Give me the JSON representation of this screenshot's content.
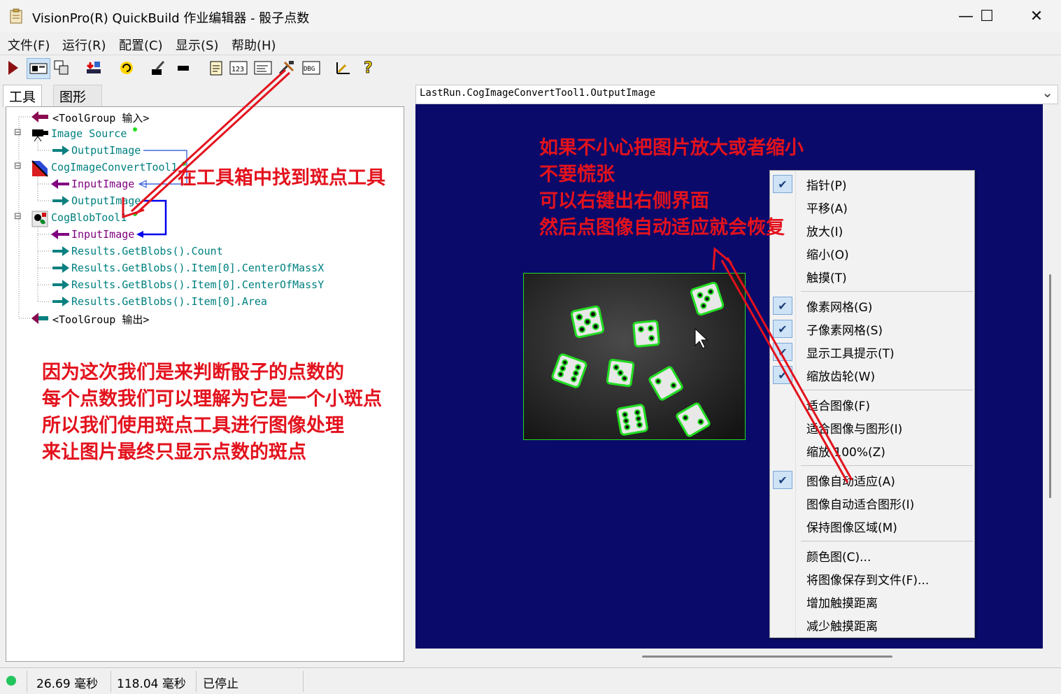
{
  "window": {
    "title": "VisionPro(R) QuickBuild 作业编辑器 - 骰子点数",
    "minimize_glyph": "—",
    "maximize_glyph": "☐",
    "close_glyph": "✕"
  },
  "menu": [
    "文件(F)",
    "运行(R)",
    "配置(C)",
    "显示(S)",
    "帮助(H)"
  ],
  "toolbar": {
    "icons": [
      "run-icon",
      "image-view-icon",
      "copy-tool-icon",
      "import-icon",
      "loop-icon",
      "edit-icon",
      "record-icon",
      "notepad-icon",
      "numeric-icon",
      "terminal-icon",
      "toolbox-icon",
      "debug-icon",
      "measure-icon",
      "help-icon"
    ],
    "num_label": "123",
    "dbg_label": "DBG"
  },
  "tabs": [
    "工具",
    "图形"
  ],
  "tree": {
    "rows": [
      "<ToolGroup 输入>",
      "Image Source",
      "OutputImage",
      "CogImageConvertTool1",
      "InputImage",
      "OutputImage",
      "CogBlobTool1",
      "InputImage",
      "Results.GetBlobs().Count",
      "Results.GetBlobs().Item[0].CenterOfMassX",
      "Results.GetBlobs().Item[0].CenterOfMassY",
      "Results.GetBlobs().Item[0].Area",
      "<ToolGroup 输出>"
    ],
    "expander": "⊟"
  },
  "viewer": {
    "combo_value": "LastRun.CogImageConvertTool1.OutputImage",
    "combo_arrow": "⌄"
  },
  "context_menu": {
    "groups": [
      [
        {
          "label": "指针(P)",
          "checked": true
        },
        {
          "label": "平移(A)",
          "checked": false
        },
        {
          "label": "放大(I)",
          "checked": false
        },
        {
          "label": "缩小(O)",
          "checked": false
        },
        {
          "label": "触摸(T)",
          "checked": false
        }
      ],
      [
        {
          "label": "像素网格(G)",
          "checked": true
        },
        {
          "label": "子像素网格(S)",
          "checked": true
        },
        {
          "label": "显示工具提示(T)",
          "checked": true
        },
        {
          "label": "缩放齿轮(W)",
          "checked": true
        }
      ],
      [
        {
          "label": "适合图像(F)",
          "checked": false
        },
        {
          "label": "适合图像与图形(I)",
          "checked": false
        },
        {
          "label": "缩放 100%(Z)",
          "checked": false
        }
      ],
      [
        {
          "label": "图像自动适应(A)",
          "checked": true
        },
        {
          "label": "图像自动适合图形(I)",
          "checked": false
        },
        {
          "label": "保持图像区域(M)",
          "checked": false
        }
      ],
      [
        {
          "label": "颜色图(C)...",
          "checked": false
        },
        {
          "label": "将图像保存到文件(F)...",
          "checked": false
        },
        {
          "label": "增加触摸距离",
          "checked": false
        },
        {
          "label": "减少触摸距离",
          "checked": false
        }
      ]
    ],
    "check_glyph": "✔"
  },
  "status": {
    "time1": "26.69 毫秒",
    "time2": "118.04 毫秒",
    "state": "已停止",
    "indicator_color": "#22c55e"
  },
  "annotations": {
    "find_blob_tool": "在工具箱中找到斑点工具",
    "zoom_hint": [
      "如果不小心把图片放大或者缩小",
      "不要慌张",
      "可以右键出右侧界面",
      "然后点图像自动适应就会恢复"
    ],
    "blob_explanation": [
      "因为这次我们是来判断骰子的点数的",
      "每个点数我们可以理解为它是一个小斑点",
      "所以我们使用斑点工具进行图像处理",
      "来让图片最终只显示点数的斑点"
    ],
    "color": "#e3121d"
  },
  "dice_image": {
    "dice_count": 9,
    "outline_color": "#22dd22"
  }
}
